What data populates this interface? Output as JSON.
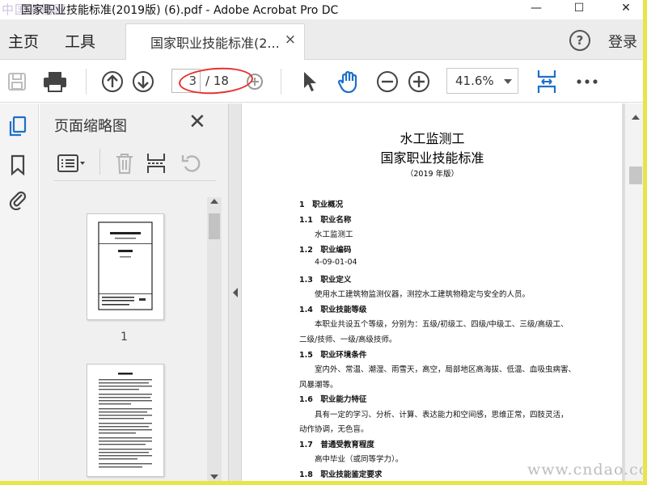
{
  "window": {
    "title": "国家职业技能标准(2019版) (6).pdf - Adobe Acrobat Pro DC",
    "watermark_left": "中国道柄网",
    "min_label": "—",
    "max_label": "☐",
    "close_label": "✕"
  },
  "menubar": {
    "home_label": "主页",
    "tools_label": "工具",
    "doc_tab_label": "国家职业技能标准(2...",
    "doc_tab_close": "×",
    "help_label": "?",
    "login_label": "登录"
  },
  "toolbar": {
    "current_page": "3",
    "page_total": "/ 18",
    "zoom_value": "41.6%",
    "icons": [
      "save-icon",
      "print-icon",
      "prev-page-icon",
      "next-page-icon",
      "select-icon",
      "hand-icon",
      "zoom-out-icon",
      "zoom-in-icon",
      "fit-page-icon",
      "more-icon"
    ],
    "highlight_color": "#e53030"
  },
  "thumb_panel": {
    "title": "页面缩略图",
    "close_label": "✕",
    "page_label": "1",
    "tool_icons": [
      "options-icon",
      "delete-icon",
      "insert-page-icon",
      "rotate-icon"
    ]
  },
  "document": {
    "title1": "水工监测工",
    "title2": "国家职业技能标准",
    "edition": "（2019 年版）",
    "lines": [
      "1　职业概况",
      "1.1　职业名称",
      "水工监测工",
      "1.2　职业编码",
      "4-09-01-04",
      "1.3　职业定义",
      "使用水工建筑物监测仪器，测控水工建筑物稳定与安全的人员。",
      "1.4　职业技能等级",
      "本职业共设五个等级，分别为：五级/初级工、四级/中级工、三级/高级工、",
      "二级/技师、一级/高级技师。",
      "1.5　职业环境条件",
      "室内外、常温、潮湿、雨雪天，高空，局部地区高海拔、低温、血吸虫病害、",
      "风暴潮等。",
      "1.6　职业能力特征",
      "具有一定的学习、分析、计算、表达能力和空间感，思维正常，四肢灵活，",
      "动作协调，无色盲。",
      "1.7　普通受教育程度",
      "高中毕业（或同等学力）。",
      "1.8　职业技能鉴定要求"
    ]
  },
  "watermark_right": "www.cndao.com"
}
